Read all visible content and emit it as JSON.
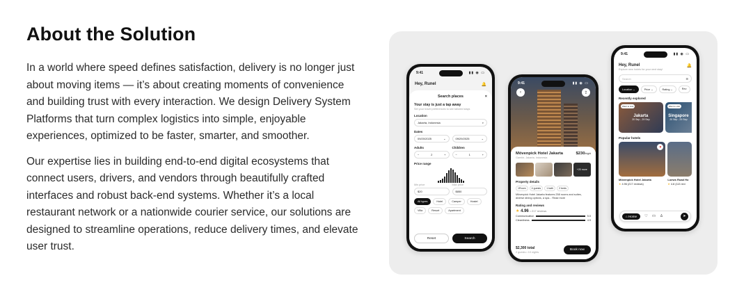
{
  "heading": "About the Solution",
  "paragraphs": [
    "In a world where speed defines satisfaction, delivery is no longer just about moving items — it’s about creating moments of convenience and building trust with every interaction. We design Delivery System Platforms that turn complex logistics into simple, enjoyable experiences, optimized to be faster, smarter, and smoother.",
    "Our expertise lies in building end-to-end digital ecosystems that connect users, drivers, and vendors through beautifully crafted interfaces and robust back-end systems. Whether it’s a local restaurant network or a nationwide courier service, our solutions are designed to streamline operations, reduce delivery times, and elevate user trust."
  ],
  "phone1": {
    "time": "9:41",
    "greeting": "Hey, Runel",
    "sheet_title": "Search places",
    "close": "×",
    "heading": "Your stay is just a tap away",
    "subheading": "Set your travel preferences to see tailored stays",
    "location_label": "Location",
    "location_value": "Jakarta, Indonesia",
    "dates_label": "Dates",
    "date_from": "09/20/2025",
    "date_to": "09/29/2025",
    "adults_label": "Adults",
    "adults_value": "2",
    "children_label": "Children",
    "children_value": "1",
    "price_label": "Price range",
    "min_label": "Min price",
    "min_value": "$20",
    "max_label": "Max price",
    "max_value": "$850",
    "types": [
      "All types",
      "Hotel",
      "Camper",
      "Hostel"
    ],
    "types2": [
      "Villa",
      "Resort",
      "Apartment"
    ],
    "reset": "Reset",
    "search": "Search"
  },
  "phone2": {
    "time": "9:41",
    "hotel_name": "Mövenpick Hotel Jakarta",
    "price": "$230",
    "price_unit": "/night",
    "address": "Gambir, Jakarta, Indonesia",
    "more_photos": "+20 more",
    "details_label": "Property details",
    "props": [
      "1Room",
      "4 guests",
      "1 bath",
      "2 beds"
    ],
    "description": "Mövenpick Hotel Jakarta features 258 rooms and suites, diverse dining options, a spa... Read more",
    "rating_label": "Rating and reviews",
    "rating": "4.96",
    "reviews": "• 217 reviews",
    "comm_label": "Communication",
    "comm_value": "5.0",
    "clean_label": "Cleanliness",
    "clean_value": "4.9",
    "total": "$2,300 total",
    "total_sub": "2 guests • 10 nights",
    "book": "Book now"
  },
  "phone3": {
    "time": "9:41",
    "greeting": "Hey, Runel",
    "subtitle": "Explore new hotels for your next stay!",
    "search_placeholder": "Search",
    "filters": [
      "Location",
      "Price",
      "Rating",
      "Rev"
    ],
    "recent_label": "Recently explored",
    "recent": [
      {
        "tag": "Want to visit",
        "city": "Jakarta",
        "dates": "20 Sep - 29 Sep"
      },
      {
        "tag": "Want to visit",
        "city": "Singapore",
        "dates": "20 Sep - 29 Sep"
      }
    ],
    "popular_label": "Popular hotels",
    "popular": [
      {
        "name": "Mövenpick Hotel Jakarta",
        "rating": "4.96 (217 reviews)"
      },
      {
        "name": "Loews Road Ho",
        "rating": "4.8 (113 revi"
      }
    ],
    "nav_home": "Home"
  }
}
